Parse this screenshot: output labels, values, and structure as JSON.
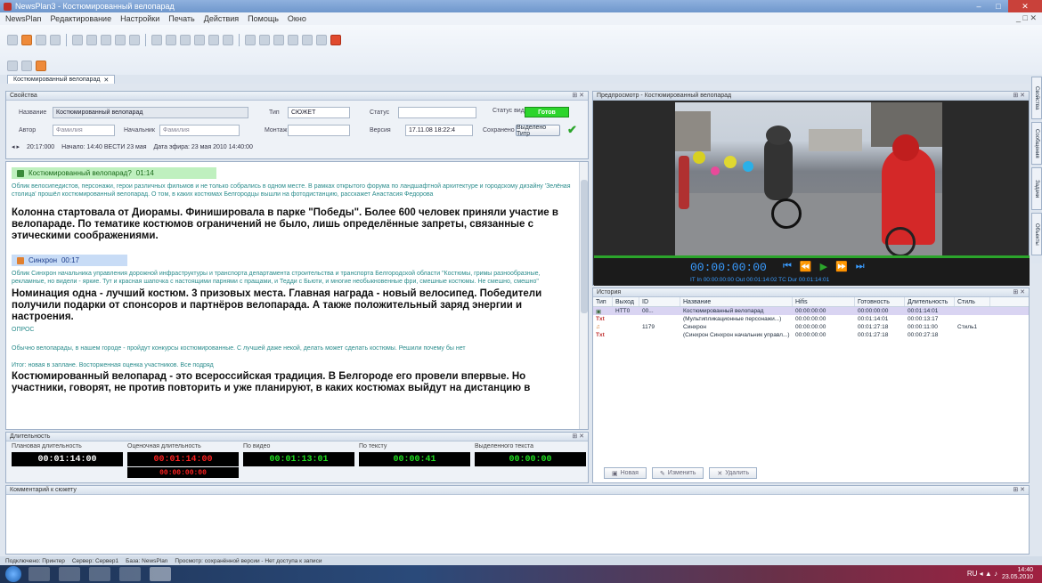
{
  "window": {
    "title": "NewsPlan3 - Костюмированный велопарад",
    "min": "–",
    "max": "□",
    "close": "✕"
  },
  "menu": [
    "NewsPlan",
    "Редактирование",
    "Настройки",
    "Печать",
    "Действия",
    "Помощь",
    "Окно"
  ],
  "mdi_controls": "_ □ ✕",
  "doc_tab": {
    "label": "Костюмированный велопарад",
    "close": "✕"
  },
  "props": {
    "header": "Свойства",
    "name_label": "Название",
    "name_value": "Костюмированный велопарад",
    "type_label": "Тип",
    "type_value": "СЮЖЕТ",
    "status_label": "Статус",
    "status_value": "Готов",
    "ready_label": "Статус видео",
    "author_label": "Автор",
    "author_value": "Фамилия",
    "head_label": "Начальник",
    "head_value": "Фамилия",
    "edition_label": "Монтаж",
    "release_label": "Версия",
    "release_value": "17.11.08 18:22:4",
    "saving_label": "Сохранено",
    "button_label": "Выделено Титр",
    "info_id": "20:17:000",
    "info_created": "Начало: 14:40 ВЕСТИ 23 мая",
    "info_date": "Дата эфира: 23 мая 2010 14:40:00"
  },
  "editor": {
    "block1_title": "Костюмированный велопарад?",
    "block1_time": "01:14",
    "block1_note": "Облик велосипедистов, персонажи, герои различных фильмов и не только собрались в одном месте. В рамках открытого форума по ландшафтной архитектуре и городскому дизайну 'Зелёная столица' прошёл костюмированный велопарад. О том, в каких костюмах Белгородцы вышли на фотодистанцию, расскажет Анастасия Федорова",
    "block1_bold": "Колонна стартовала от Диорамы. Финишировала в парке \"Победы\". Более 600 человек приняли участие в велопараде. По тематике костюмов ограничений не было, лишь определённые запреты, связанные с этическими соображениями.",
    "block2_title": "Синхрон",
    "block2_time": "00:17",
    "block2_note": "Облик Синхрон начальника управления дорожной инфраструктуры и транспорта департамента строительства и транспорта Белгородской области \"Костюмы, гримы разнообразные, рекламные, но видели - яркие. Тут и красная шапочка с настоящими парнями с пращами, и Тедди с Бьюти, и многие необыкновенные фри, смешные костюмы. Не смешно, смешно\"",
    "block2_bold": "Номинация одна - лучший костюм. 3 призовых места. Главная награда - новый велосипед. Победители получили подарки от спонсоров и партнёров велопарада. А также положительный заряд энергии и настроения.",
    "block2_tag": "ОПРОС",
    "note3": "Обычно велопарады, в нашем городе - пройдут конкурсы костюмированные. С лучшей даже некой, делать может сделать костюмы. Решили почему бы нет",
    "note4": "Итог: новая в заплане. Восторженная оценка участников. Все подряд",
    "block3_bold": "Костюмированный велопарад - это всероссийская традиция. В Белгороде его провели впервые. Но участники, говорят, не против повторить и уже планируют, в каких костюмах выйдут на дистанцию в"
  },
  "durations": {
    "header": "Длительность",
    "planned_label": "Плановая длительность",
    "planned_value": "00:01:14:00",
    "estimated_label": "Оценочная длительность",
    "estimated_value": "00:01:14:00",
    "estimated_value2": "00:00:00:00",
    "video_label": "По видео",
    "video_value": "00:01:13:01",
    "text_label": "По тексту",
    "text_value": "00:00:41",
    "selected_label": "Выделенного текста",
    "selected_value": "00:00:00"
  },
  "comments": {
    "header": "Комментарий к сюжету"
  },
  "player": {
    "header": "Предпросмотр - Костюмированный велопарад",
    "timecode": "00:00:00:00",
    "sub": "IT  In 00:00:00:00  Out 00:01:14:02  TC  Dur 00:01:14:01"
  },
  "story": {
    "header": "История",
    "columns": [
      "Тип",
      "Выход",
      "ID",
      "Название",
      "Hifis",
      "Готовность",
      "Длительность",
      "Стиль"
    ],
    "rows": [
      {
        "type": "▣",
        "out": "НТТ0",
        "id": "00...",
        "name": "Костюмированный велопарад",
        "hifis": "00:00:00:00",
        "ready": "00:00:00:00",
        "dur": "00:01:14:01",
        "style": ""
      },
      {
        "type": "Txt",
        "out": "",
        "id": "",
        "name": "(Мультипликационные персонажи...)",
        "hifis": "00:00:00:00",
        "ready": "00:01:14:01",
        "dur": "00:00:13:17",
        "style": ""
      },
      {
        "type": "♫",
        "out": "",
        "id": "1179",
        "name": "Синхрон",
        "hifis": "00:00:00:00",
        "ready": "00:01:27:18",
        "dur": "00:00:11:00",
        "style": "Стиль1"
      },
      {
        "type": "Txt",
        "out": "",
        "id": "",
        "name": "(Синхрон Синхрон начальник управл...)",
        "hifis": "00:00:00:00",
        "ready": "00:01:27:18",
        "dur": "00:00:27:18",
        "style": ""
      }
    ],
    "btn_new": "Новая",
    "btn_edit": "Изменить",
    "btn_delete": "Удалить"
  },
  "sidetabs": [
    "Свойства",
    "Сообщения",
    "Задачи",
    "Объекты"
  ],
  "statusbar": [
    "Подключено: Принтер",
    "Сервер: Сервер1",
    "База: NewsPlan",
    "Просмотр: сохранённой версии - Нет доступа к записи"
  ],
  "taskbar": {
    "time": "14:40",
    "date": "23.05.2010",
    "tray": "RU ◂ ▲ ♪"
  },
  "colors": {
    "accent": "#6f97cc",
    "status_ok": "#2cd52c",
    "timecode": "#3a9cff"
  }
}
